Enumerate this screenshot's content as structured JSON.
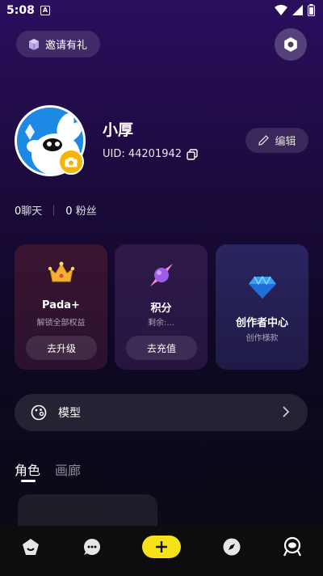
{
  "status_bar": {
    "time": "5:08",
    "notification_letter": "A"
  },
  "header": {
    "invite_label": "邀请有礼"
  },
  "profile": {
    "username": "小厚",
    "uid_label": "UID: 44201942"
  },
  "edit_label": "编辑",
  "stats": [
    {
      "count": "0",
      "label": "聊天"
    },
    {
      "count": "0",
      "label": "粉丝"
    }
  ],
  "cards": {
    "pada": {
      "title": "Pada+",
      "subtitle": "解锁全部权益",
      "button": "去升级"
    },
    "points": {
      "title": "积分",
      "subtitle": "剩余:...",
      "button": "去充值"
    },
    "creator": {
      "title": "创作者中心",
      "subtitle": "创作様款"
    }
  },
  "model": {
    "label": "模型"
  },
  "tabs": [
    {
      "label": "角色",
      "active": true
    },
    {
      "label": "画廊",
      "active": false
    }
  ],
  "colors": {
    "accent_yellow": "#f7e117",
    "camera_badge": "#f5b400",
    "avatar_bg": "#1e88e5"
  },
  "icons": {
    "invite": "gift-box-icon",
    "settings": "gear-icon",
    "edit": "pencil-icon",
    "copy": "copy-icon",
    "pada": "crown-icon",
    "points": "candy-icon",
    "creator": "diamond-icon",
    "model": "palette-icon",
    "nav": [
      "home-icon",
      "chat-icon",
      "add-icon",
      "discover-icon",
      "profile-icon"
    ]
  }
}
